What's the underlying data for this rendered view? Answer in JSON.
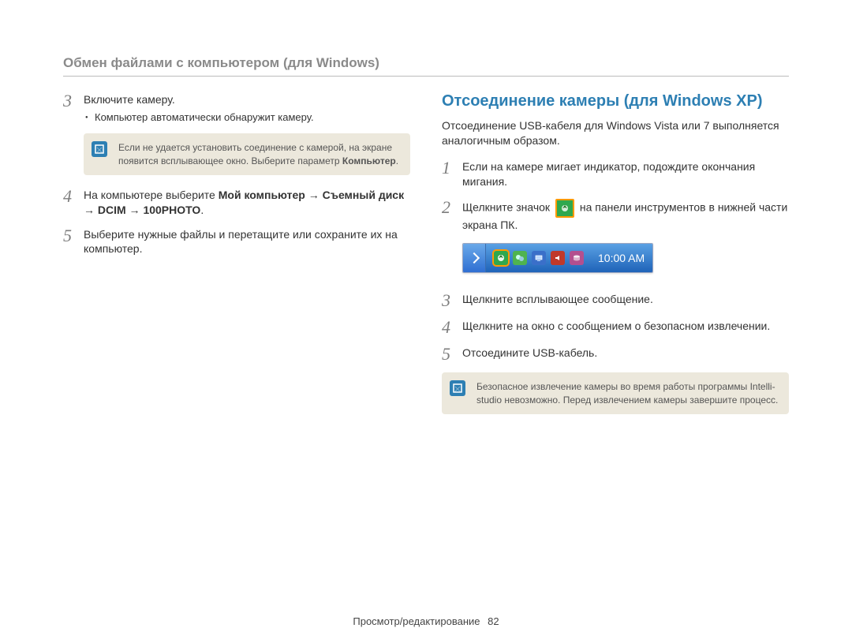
{
  "header": {
    "title": "Обмен файлами с компьютером (для Windows)"
  },
  "left": {
    "steps": {
      "3": {
        "text": "Включите камеру.",
        "bullet": "Компьютер автоматически обнаружит камеру."
      },
      "4": {
        "prefix": "На компьютере выберите ",
        "bold": "Мой компьютер → Съемный диск → DCIM → 100PHOTO",
        "suffix": "."
      },
      "5": {
        "text": "Выберите нужные файлы и перетащите или сохраните их на компьютер."
      }
    },
    "note": {
      "prefix": "Если не удается установить соединение с камерой, на экране появится всплывающее окно. Выберите параметр ",
      "bold": "Компьютер",
      "suffix": "."
    }
  },
  "right": {
    "title": "Отсоединение камеры (для Windows XP)",
    "intro": "Отсоединение USB-кабеля для Windows Vista или 7 выполняется аналогичным образом.",
    "steps": {
      "1": {
        "text": "Если на камере мигает индикатор, подождите окончания мигания."
      },
      "2": {
        "pre": "Щелкните значок",
        "post": "на панели инструментов в нижней части экрана ПК."
      },
      "3": {
        "text": "Щелкните всплывающее сообщение."
      },
      "4": {
        "text": "Щелкните на окно с сообщением о безопасном извлечении."
      },
      "5": {
        "text": "Отсоедините USB-кабель."
      }
    },
    "note": "Безопасное извлечение камеры во время работы программы Intelli-studio невозможно. Перед извлечением камеры завершите процесс.",
    "taskbar": {
      "clock": "10:00 AM",
      "icons": [
        "safely-remove",
        "chat",
        "display",
        "volume",
        "disk"
      ]
    }
  },
  "footer": {
    "label": "Просмотр/редактирование",
    "page": "82"
  }
}
